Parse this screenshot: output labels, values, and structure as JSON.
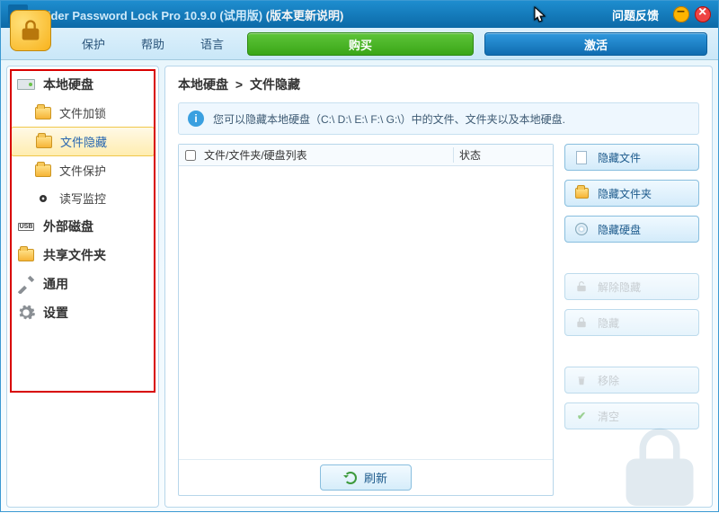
{
  "title": {
    "app_name": "Folder Password Lock Pro",
    "version": "10.9.0",
    "trial": "(试用版)",
    "update_note": "(版本更新说明)",
    "feedback": "问题反馈"
  },
  "menu": {
    "protect": "保护",
    "help": "帮助",
    "language": "语言",
    "buy": "购买",
    "activate": "激活"
  },
  "sidebar": {
    "local_disk": "本地硬盘",
    "items": [
      {
        "label": "文件加锁"
      },
      {
        "label": "文件隐藏",
        "active": true
      },
      {
        "label": "文件保护"
      },
      {
        "label": "读写监控"
      }
    ],
    "external": "外部磁盘",
    "shared": "共享文件夹",
    "general": "通用",
    "settings": "设置"
  },
  "breadcrumb": {
    "a": "本地硬盘",
    "sep": ">",
    "b": "文件隐藏"
  },
  "hint": "您可以隐藏本地硬盘（C:\\ D:\\ E:\\ F:\\ G:\\）中的文件、文件夹以及本地硬盘.",
  "list": {
    "col_name": "文件/文件夹/硬盘列表",
    "col_status": "状态",
    "refresh": "刷新"
  },
  "actions": {
    "hide_file": "隐藏文件",
    "hide_folder": "隐藏文件夹",
    "hide_disk": "隐藏硬盘",
    "unhide": "解除隐藏",
    "hide": "隐藏",
    "remove": "移除",
    "clear": "清空"
  }
}
